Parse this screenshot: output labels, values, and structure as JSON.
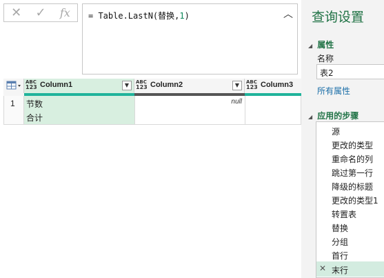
{
  "formula_bar": {
    "cancel_icon": "close-icon",
    "confirm_icon": "check-icon",
    "fx_label": "fx",
    "formula_prefix": "= Table.LastN(替换,",
    "formula_arg": "1",
    "formula_suffix": ")"
  },
  "grid": {
    "columns": [
      {
        "type_top": "ABC",
        "type_bottom": "123",
        "name": "Column1",
        "quality_color": "#1fb39b"
      },
      {
        "type_top": "ABC",
        "type_bottom": "123",
        "name": "Column2",
        "quality_color": "#555555"
      },
      {
        "type_top": "ABC",
        "type_bottom": "123",
        "name": "Column3",
        "quality_color": "#1fb39b"
      }
    ],
    "rows": [
      {
        "index": "1",
        "col1_line1": "节数",
        "col1_line2": "合计",
        "col2": "null",
        "col3": ""
      }
    ]
  },
  "query_settings": {
    "title": "查询设置",
    "properties_heading": "属性",
    "name_label": "名称",
    "name_value": "表2",
    "all_properties_link": "所有属性",
    "applied_steps_heading": "应用的步骤",
    "steps": [
      "源",
      "更改的类型",
      "重命名的列",
      "跳过第一行",
      "降级的标题",
      "更改的类型1",
      "转置表",
      "替换",
      "分组",
      "首行",
      "末行"
    ],
    "selected_step": "末行"
  },
  "colors": {
    "accent_green": "#217346",
    "selected_header": "#d8efe0",
    "selected_step_bg": "#d3ece0",
    "pane_bg": "#f3f3f3"
  }
}
